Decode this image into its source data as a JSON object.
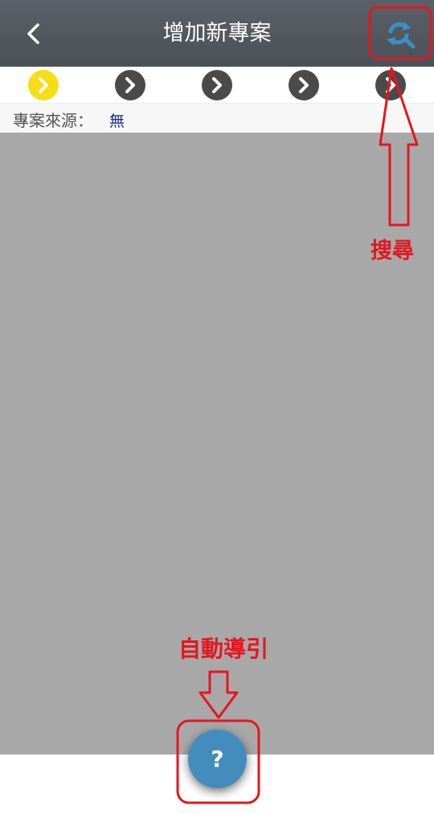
{
  "header": {
    "title": "增加新專案",
    "back_icon": "chevron-left-icon",
    "search_icon": "refresh-search-icon"
  },
  "steps": [
    {
      "state": "active"
    },
    {
      "state": "inactive"
    },
    {
      "state": "inactive"
    },
    {
      "state": "inactive"
    },
    {
      "state": "inactive"
    }
  ],
  "project_source": {
    "label": "專案來源：",
    "value": "無"
  },
  "help_button": {
    "label": "?"
  },
  "annotations": {
    "search": "搜尋",
    "auto_guide": "自動導引"
  },
  "colors": {
    "header_bg": "#51575e",
    "step_active": "#f7dd17",
    "step_inactive": "#4a4a4a",
    "content_bg": "#a8a8a8",
    "help_button": "#438dbd",
    "annotation_red": "#e5161f",
    "search_icon": "#3a8fc7"
  }
}
